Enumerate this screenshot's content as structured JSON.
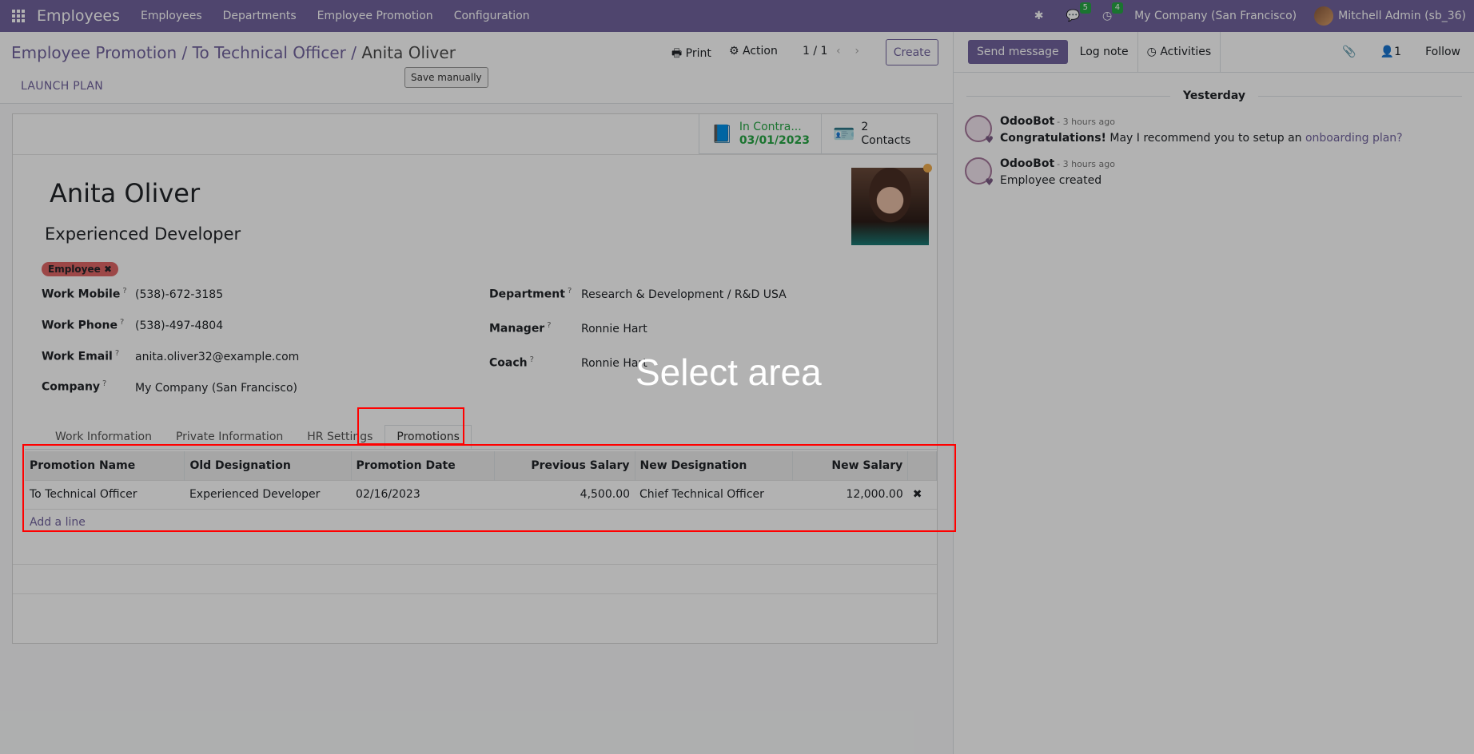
{
  "navbar": {
    "brand": "Employees",
    "menus": [
      "Employees",
      "Departments",
      "Employee Promotion",
      "Configuration"
    ],
    "messages_count": "5",
    "activities_count": "4",
    "company": "My Company (San Francisco)",
    "user": "Mitchell Admin (sb_36)"
  },
  "control_panel": {
    "breadcrumb_parent": "Employee Promotion",
    "breadcrumb_mid": "To Technical Officer",
    "breadcrumb_current": "Anita Oliver",
    "print_label": "Print",
    "action_label": "Action",
    "pager": "1 / 1",
    "create_label": "Create",
    "tooltip": "Save manually"
  },
  "statusbar": {
    "launch_plan_label": "LAUNCH PLAN"
  },
  "stat_buttons": {
    "contract_label": "In Contra...",
    "contract_date": "03/01/2023",
    "contacts_count": "2",
    "contacts_label": "Contacts"
  },
  "employee": {
    "name": "Anita Oliver",
    "job_title": "Experienced Developer",
    "tag": "Employee",
    "fields_left": [
      {
        "label": "Work Mobile",
        "value": "(538)-672-3185"
      },
      {
        "label": "Work Phone",
        "value": "(538)-497-4804"
      },
      {
        "label": "Work Email",
        "value": "anita.oliver32@example.com"
      },
      {
        "label": "Company",
        "value": "My Company (San Francisco)"
      }
    ],
    "fields_right": [
      {
        "label": "Department",
        "value": "Research & Development / R&D USA"
      },
      {
        "label": "Manager",
        "value": "Ronnie Hart"
      },
      {
        "label": "Coach",
        "value": "Ronnie Hart"
      }
    ]
  },
  "tabs": [
    "Work Information",
    "Private Information",
    "HR Settings",
    "Promotions"
  ],
  "promotions": {
    "columns": [
      "Promotion Name",
      "Old Designation",
      "Promotion Date",
      "Previous Salary",
      "New Designation",
      "New Salary"
    ],
    "rows": [
      [
        "To Technical Officer",
        "Experienced Developer",
        "02/16/2023",
        "4,500.00",
        "Chief Technical Officer",
        "12,000.00"
      ]
    ],
    "add_line": "Add a line"
  },
  "chatter": {
    "send_message": "Send message",
    "log_note": "Log note",
    "activities": "Activities",
    "followers_count": "1",
    "follow": "Follow",
    "day": "Yesterday",
    "messages": [
      {
        "author": "OdooBot",
        "time": "- 3 hours ago",
        "bold": "Congratulations!",
        "text": " May I recommend you to setup an ",
        "link": "onboarding plan?"
      },
      {
        "author": "OdooBot",
        "time": "- 3 hours ago",
        "text": "Employee created"
      }
    ]
  },
  "overlay": {
    "label": "Select area"
  }
}
